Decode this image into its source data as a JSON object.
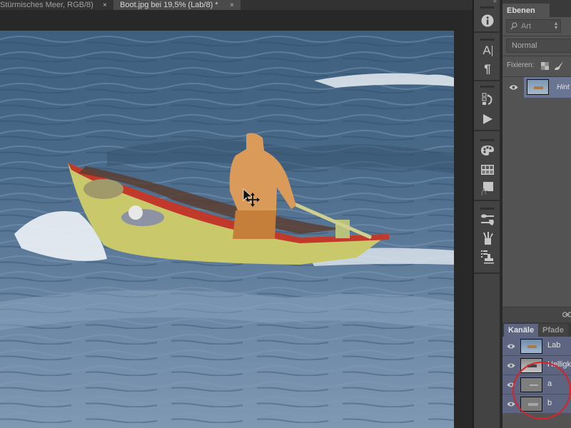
{
  "document_tabs": [
    {
      "label": "Stürmisches Meer, RGB/8)",
      "close_icon": "close-icon",
      "active": false
    },
    {
      "label": "Boot.jpg bei 19,5% (Lab/8) *",
      "close_icon": "close-icon",
      "active": true
    }
  ],
  "close_glyph": "×",
  "dock": {
    "collapse_glyph": "«",
    "groups": [
      {
        "icons": [
          "info-icon"
        ]
      },
      {
        "icons": [
          "character-icon",
          "paragraph-icon"
        ]
      },
      {
        "icons": [
          "history-icon",
          "actions-play-icon"
        ]
      },
      {
        "icons": [
          "color-palette-icon",
          "swatches-icon",
          "styles-fx-icon"
        ]
      },
      {
        "icons": [
          "brush-presets-icon",
          "brush-icon",
          "clone-source-icon"
        ]
      }
    ],
    "character_glyph": "A",
    "paragraph_glyph": "¶",
    "info_glyph": "i",
    "fx_glyph": "fx"
  },
  "layers_panel": {
    "tab_label": "Ebenen",
    "search_placeholder": "Art",
    "search_icon_glyph": "⚲",
    "blend_mode": "Normal",
    "lock_label": "Fixieren:",
    "layers": [
      {
        "name": "Hintergrund",
        "visible_text": "Hint",
        "visible": true,
        "selected": true
      }
    ]
  },
  "channels_panel": {
    "tabs": [
      "Kanäle",
      "Pfade"
    ],
    "active_tab": "Kanäle",
    "channels": [
      {
        "name": "Lab",
        "visible": true
      },
      {
        "name": "Helligkeit",
        "visible_text": "Helligke",
        "visible": true
      },
      {
        "name": "a",
        "visible": true
      },
      {
        "name": "b",
        "visible": true
      }
    ]
  },
  "annotation": {
    "type": "circle",
    "target": "channels a and b",
    "color": "#d8232a"
  },
  "colors": {
    "app_bg": "#282828",
    "panel_bg": "#535353",
    "selected_row": "#6a7594",
    "channel_row": "#5d6580",
    "boat_hull": "#c9c86a",
    "boat_trim": "#c0392b",
    "raincoat": "#d99a5a",
    "water": "#4f6d8c"
  }
}
